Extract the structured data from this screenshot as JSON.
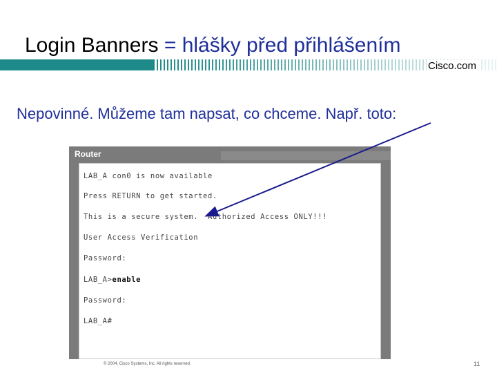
{
  "slide": {
    "title_part1": "Login Banners",
    "title_equals": " = ",
    "title_part2": "hlášky před přihlášením",
    "subtitle": "Nepovinné. Můžeme tam napsat, co chceme. Např. toto:",
    "brand": "Cisco.com",
    "footer": "© 2004, Cisco Systems, Inc. All rights reserved.",
    "page_number": "11"
  },
  "router": {
    "title": "Router",
    "lines": [
      "LAB_A con0 is now available",
      "Press RETURN to get started.",
      "This is a secure system.  Authorized Access ONLY!!!",
      "User Access Verification",
      "Password:",
      "LAB_A>",
      "Password:",
      "LAB_A#"
    ],
    "enable_command": "enable"
  },
  "colors": {
    "accent": "#1f2f9a",
    "band": "#1f8a8a",
    "frame": "#7b7b7b"
  }
}
